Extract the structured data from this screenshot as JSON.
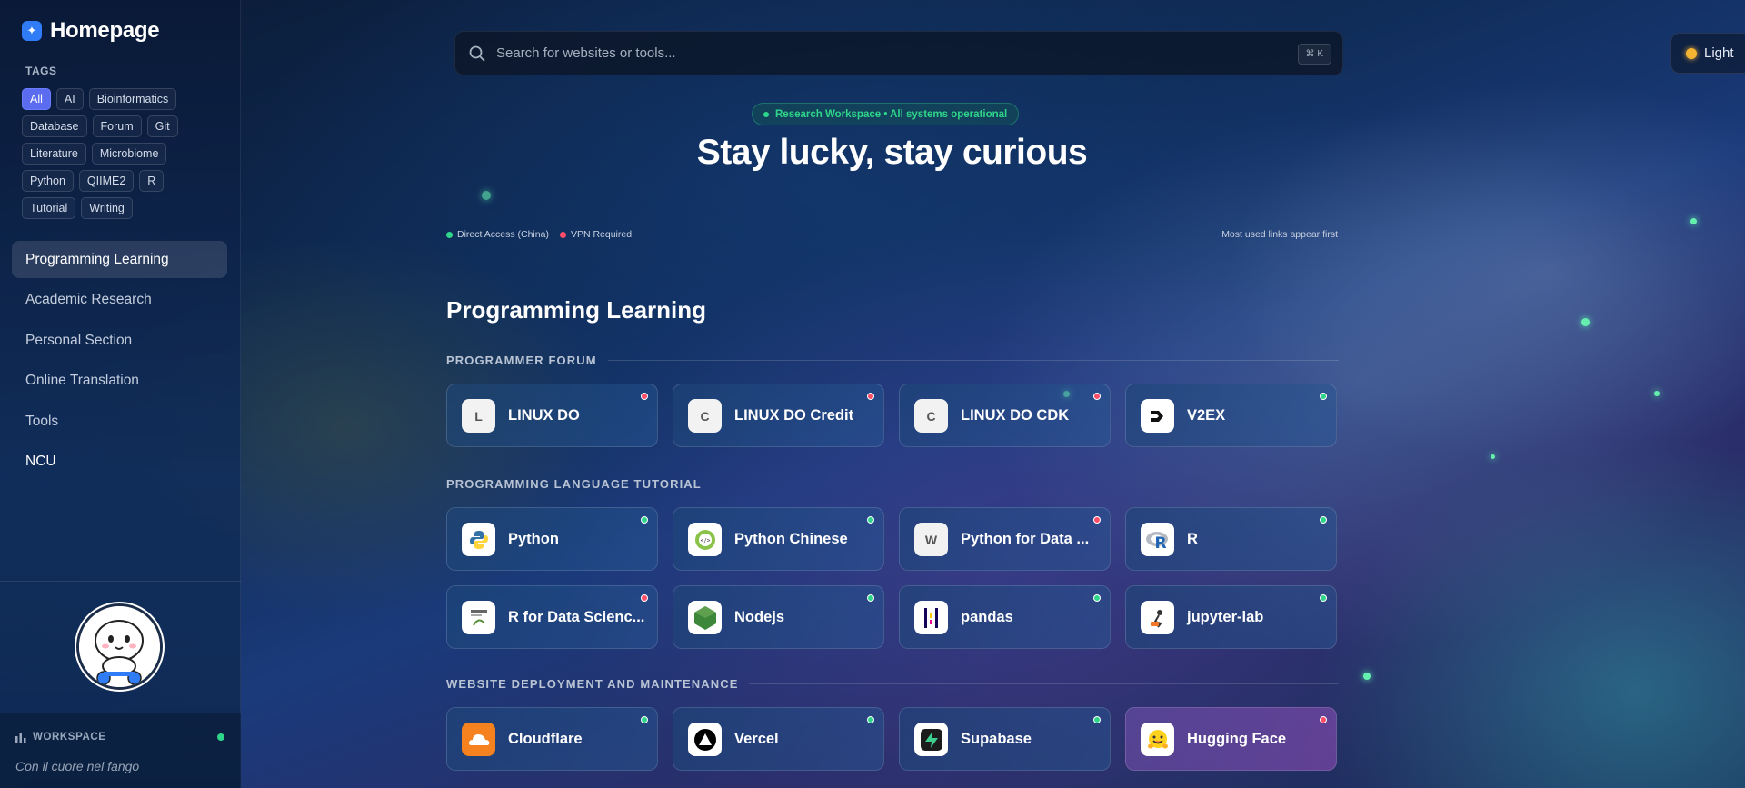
{
  "brand": {
    "title": "Homepage",
    "icon": "sparkle-icon"
  },
  "tags": {
    "title": "TAGS",
    "items": [
      "All",
      "AI",
      "Bioinformatics",
      "Database",
      "Forum",
      "Git",
      "Literature",
      "Microbiome",
      "Python",
      "QIIME2",
      "R",
      "Tutorial",
      "Writing"
    ],
    "active": "All"
  },
  "nav": {
    "items": [
      "Programming Learning",
      "Academic Research",
      "Personal Section",
      "Online Translation",
      "Tools",
      "NCU"
    ],
    "active": "Programming Learning"
  },
  "workspace": {
    "title": "WORKSPACE",
    "quote": "Con il cuore nel fango"
  },
  "search": {
    "placeholder": "Search for websites or tools...",
    "shortcut": "⌘ K"
  },
  "theme": {
    "label": "Light"
  },
  "status": {
    "text": "Research Workspace • All systems operational"
  },
  "hero": {
    "title": "Stay lucky, stay curious"
  },
  "legend": {
    "direct": "Direct Access (China)",
    "vpn": "VPN Required",
    "hint": "Most used links appear first"
  },
  "colors": {
    "accent": "#5b6cf0",
    "green": "#2fd58a",
    "red": "#ff4d6a"
  },
  "section": {
    "title": "Programming Learning",
    "groups": [
      {
        "title": "PROGRAMMER FORUM",
        "cards": [
          {
            "name": "LINUX DO",
            "icon": "L",
            "status": "red"
          },
          {
            "name": "LINUX DO Credit",
            "icon": "C",
            "status": "red"
          },
          {
            "name": "LINUX DO CDK",
            "icon": "C",
            "status": "red"
          },
          {
            "name": "V2EX",
            "icon": "v2ex-logo-icon",
            "status": "green"
          }
        ]
      },
      {
        "title": "PROGRAMMING LANGUAGE TUTORIAL",
        "cards": [
          {
            "name": "Python",
            "icon": "python-logo-icon",
            "status": "green"
          },
          {
            "name": "Python Chinese",
            "icon": "code-badge-icon",
            "status": "green"
          },
          {
            "name": "Python for Data ...",
            "icon": "W",
            "status": "red"
          },
          {
            "name": "R",
            "icon": "r-logo-icon",
            "status": "green"
          },
          {
            "name": "R for Data Scienc...",
            "icon": "book-cover-icon",
            "status": "red"
          },
          {
            "name": "Nodejs",
            "icon": "nodejs-hexagon-icon",
            "status": "green"
          },
          {
            "name": "pandas",
            "icon": "pandas-logo-icon",
            "status": "green"
          },
          {
            "name": "jupyter-lab",
            "icon": "jupyter-figure-icon",
            "status": "green"
          }
        ]
      },
      {
        "title": "WEBSITE DEPLOYMENT AND MAINTENANCE",
        "cards": [
          {
            "name": "Cloudflare",
            "icon": "cloudflare-icon",
            "status": "green"
          },
          {
            "name": "Vercel",
            "icon": "vercel-triangle-icon",
            "status": "green"
          },
          {
            "name": "Supabase",
            "icon": "supabase-bolt-icon",
            "status": "green"
          },
          {
            "name": "Hugging Face",
            "icon": "hugging-face-icon",
            "status": "red"
          }
        ]
      }
    ]
  }
}
